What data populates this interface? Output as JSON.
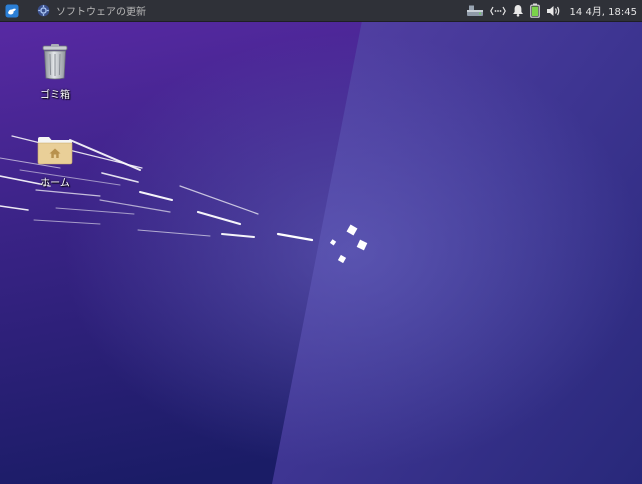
{
  "panel": {
    "task_label": "ソフトウェアの更新",
    "clock": "14 4月, 18:45"
  },
  "desktop": {
    "icons": [
      {
        "label": "ゴミ箱",
        "icon": "trash-icon"
      },
      {
        "label": "ホーム",
        "icon": "home-folder-icon"
      }
    ]
  },
  "colors": {
    "panel_bg": "#2f3138",
    "wallpaper_top": "#5a2aa8",
    "wallpaper_bottom": "#1a1d6a",
    "battery": "#7bd34a"
  }
}
